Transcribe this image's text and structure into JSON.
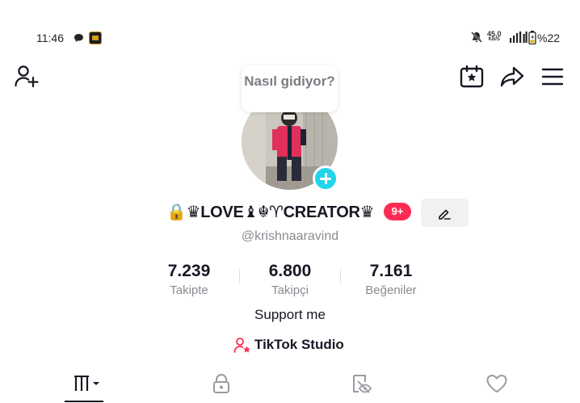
{
  "status_bar": {
    "time": "11:46",
    "net_speed": "45,0",
    "net_speed_unit": "KB/S",
    "battery": "%22",
    "icons": [
      "chat-bubble-icon",
      "app-icon",
      "mute-bell-icon",
      "signal-icon",
      "battery-icon"
    ]
  },
  "top_bar": {
    "icons": [
      "add-user-icon",
      "calendar-star-icon",
      "share-arrow-icon",
      "menu-icon"
    ]
  },
  "note": {
    "text": "Nasıl gidiyor?"
  },
  "profile": {
    "display_name": "🔒♛LOVE♝☬♈CREATOR♛",
    "notification_badge": "9+",
    "username": "@krishnaaravind",
    "bio": "Support me",
    "studio_label": "TikTok Studio"
  },
  "stats": {
    "following": {
      "value": "7.239",
      "label": "Takipte"
    },
    "followers": {
      "value": "6.800",
      "label": "Takipçi"
    },
    "likes": {
      "value": "7.161",
      "label": "Beğeniler"
    }
  },
  "tabs": [
    {
      "name": "videos",
      "icon": "grid-bars-icon",
      "active": true
    },
    {
      "name": "private",
      "icon": "lock-icon",
      "active": false
    },
    {
      "name": "reposts",
      "icon": "repost-eye-icon",
      "active": false
    },
    {
      "name": "liked",
      "icon": "heart-icon",
      "active": false
    }
  ],
  "colors": {
    "accent_badge": "#fe2c55",
    "add_story": "#20d5ec",
    "text_primary": "#161823",
    "text_secondary": "#8a8b91"
  }
}
